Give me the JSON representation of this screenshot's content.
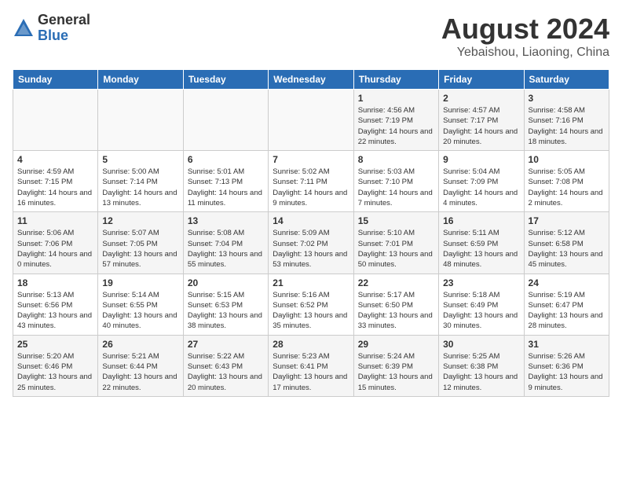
{
  "header": {
    "logo_general": "General",
    "logo_blue": "Blue",
    "month_year": "August 2024",
    "location": "Yebaishou, Liaoning, China"
  },
  "weekdays": [
    "Sunday",
    "Monday",
    "Tuesday",
    "Wednesday",
    "Thursday",
    "Friday",
    "Saturday"
  ],
  "weeks": [
    [
      {
        "day": "",
        "info": ""
      },
      {
        "day": "",
        "info": ""
      },
      {
        "day": "",
        "info": ""
      },
      {
        "day": "",
        "info": ""
      },
      {
        "day": "1",
        "info": "Sunrise: 4:56 AM\nSunset: 7:19 PM\nDaylight: 14 hours\nand 22 minutes."
      },
      {
        "day": "2",
        "info": "Sunrise: 4:57 AM\nSunset: 7:17 PM\nDaylight: 14 hours\nand 20 minutes."
      },
      {
        "day": "3",
        "info": "Sunrise: 4:58 AM\nSunset: 7:16 PM\nDaylight: 14 hours\nand 18 minutes."
      }
    ],
    [
      {
        "day": "4",
        "info": "Sunrise: 4:59 AM\nSunset: 7:15 PM\nDaylight: 14 hours\nand 16 minutes."
      },
      {
        "day": "5",
        "info": "Sunrise: 5:00 AM\nSunset: 7:14 PM\nDaylight: 14 hours\nand 13 minutes."
      },
      {
        "day": "6",
        "info": "Sunrise: 5:01 AM\nSunset: 7:13 PM\nDaylight: 14 hours\nand 11 minutes."
      },
      {
        "day": "7",
        "info": "Sunrise: 5:02 AM\nSunset: 7:11 PM\nDaylight: 14 hours\nand 9 minutes."
      },
      {
        "day": "8",
        "info": "Sunrise: 5:03 AM\nSunset: 7:10 PM\nDaylight: 14 hours\nand 7 minutes."
      },
      {
        "day": "9",
        "info": "Sunrise: 5:04 AM\nSunset: 7:09 PM\nDaylight: 14 hours\nand 4 minutes."
      },
      {
        "day": "10",
        "info": "Sunrise: 5:05 AM\nSunset: 7:08 PM\nDaylight: 14 hours\nand 2 minutes."
      }
    ],
    [
      {
        "day": "11",
        "info": "Sunrise: 5:06 AM\nSunset: 7:06 PM\nDaylight: 14 hours\nand 0 minutes."
      },
      {
        "day": "12",
        "info": "Sunrise: 5:07 AM\nSunset: 7:05 PM\nDaylight: 13 hours\nand 57 minutes."
      },
      {
        "day": "13",
        "info": "Sunrise: 5:08 AM\nSunset: 7:04 PM\nDaylight: 13 hours\nand 55 minutes."
      },
      {
        "day": "14",
        "info": "Sunrise: 5:09 AM\nSunset: 7:02 PM\nDaylight: 13 hours\nand 53 minutes."
      },
      {
        "day": "15",
        "info": "Sunrise: 5:10 AM\nSunset: 7:01 PM\nDaylight: 13 hours\nand 50 minutes."
      },
      {
        "day": "16",
        "info": "Sunrise: 5:11 AM\nSunset: 6:59 PM\nDaylight: 13 hours\nand 48 minutes."
      },
      {
        "day": "17",
        "info": "Sunrise: 5:12 AM\nSunset: 6:58 PM\nDaylight: 13 hours\nand 45 minutes."
      }
    ],
    [
      {
        "day": "18",
        "info": "Sunrise: 5:13 AM\nSunset: 6:56 PM\nDaylight: 13 hours\nand 43 minutes."
      },
      {
        "day": "19",
        "info": "Sunrise: 5:14 AM\nSunset: 6:55 PM\nDaylight: 13 hours\nand 40 minutes."
      },
      {
        "day": "20",
        "info": "Sunrise: 5:15 AM\nSunset: 6:53 PM\nDaylight: 13 hours\nand 38 minutes."
      },
      {
        "day": "21",
        "info": "Sunrise: 5:16 AM\nSunset: 6:52 PM\nDaylight: 13 hours\nand 35 minutes."
      },
      {
        "day": "22",
        "info": "Sunrise: 5:17 AM\nSunset: 6:50 PM\nDaylight: 13 hours\nand 33 minutes."
      },
      {
        "day": "23",
        "info": "Sunrise: 5:18 AM\nSunset: 6:49 PM\nDaylight: 13 hours\nand 30 minutes."
      },
      {
        "day": "24",
        "info": "Sunrise: 5:19 AM\nSunset: 6:47 PM\nDaylight: 13 hours\nand 28 minutes."
      }
    ],
    [
      {
        "day": "25",
        "info": "Sunrise: 5:20 AM\nSunset: 6:46 PM\nDaylight: 13 hours\nand 25 minutes."
      },
      {
        "day": "26",
        "info": "Sunrise: 5:21 AM\nSunset: 6:44 PM\nDaylight: 13 hours\nand 22 minutes."
      },
      {
        "day": "27",
        "info": "Sunrise: 5:22 AM\nSunset: 6:43 PM\nDaylight: 13 hours\nand 20 minutes."
      },
      {
        "day": "28",
        "info": "Sunrise: 5:23 AM\nSunset: 6:41 PM\nDaylight: 13 hours\nand 17 minutes."
      },
      {
        "day": "29",
        "info": "Sunrise: 5:24 AM\nSunset: 6:39 PM\nDaylight: 13 hours\nand 15 minutes."
      },
      {
        "day": "30",
        "info": "Sunrise: 5:25 AM\nSunset: 6:38 PM\nDaylight: 13 hours\nand 12 minutes."
      },
      {
        "day": "31",
        "info": "Sunrise: 5:26 AM\nSunset: 6:36 PM\nDaylight: 13 hours\nand 9 minutes."
      }
    ]
  ]
}
